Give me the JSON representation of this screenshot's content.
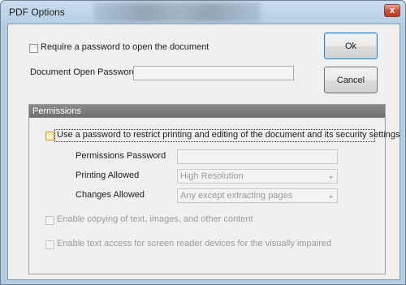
{
  "window": {
    "title": "PDF Options",
    "close_label": "x"
  },
  "top": {
    "require_password_label": "Require a password to open the document",
    "open_password_label": "Document Open Password:",
    "open_password_value": ""
  },
  "buttons": {
    "ok": "Ok",
    "cancel": "Cancel"
  },
  "permissions": {
    "header": "Permissions",
    "use_password_label": "Use a password to restrict printing and editing of the document and its security settings",
    "permissions_password_label": "Permissions Password",
    "permissions_password_value": "",
    "printing_allowed_label": "Printing Allowed",
    "printing_allowed_value": "High Resolution",
    "changes_allowed_label": "Changes Allowed",
    "changes_allowed_value": "Any except extracting pages",
    "enable_copying_label": "Enable copying of text, images, and other content",
    "enable_access_label": "Enable text access for screen reader devices for the visually impaired"
  }
}
